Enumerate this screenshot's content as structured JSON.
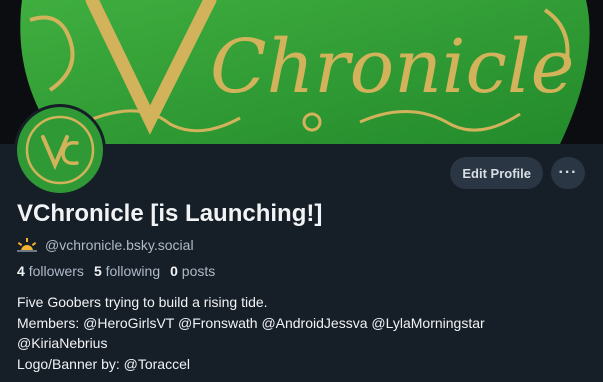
{
  "banner": {
    "logo_text": "VChronicle",
    "colors": {
      "green": "#2f9a35",
      "gold": "#d2b25a",
      "dark": "#0b0d10"
    }
  },
  "profile": {
    "display_name": "VChronicle [is Launching!]",
    "handle_icon": "sunrise-icon",
    "handle": "@vchronicle.bsky.social",
    "stats": [
      {
        "num": "4",
        "label": "followers"
      },
      {
        "num": "5",
        "label": "following"
      },
      {
        "num": "0",
        "label": "posts"
      }
    ],
    "bio_lines": [
      "Five Goobers trying to build a rising tide.",
      "Members: @HeroGirlsVT @Fronswath @AndroidJessva @LylaMorningstar",
      "@KiriaNebrius",
      "Logo/Banner by: @Toraccel"
    ]
  },
  "actions": {
    "edit_profile_label": "Edit Profile",
    "more_label": "···"
  }
}
